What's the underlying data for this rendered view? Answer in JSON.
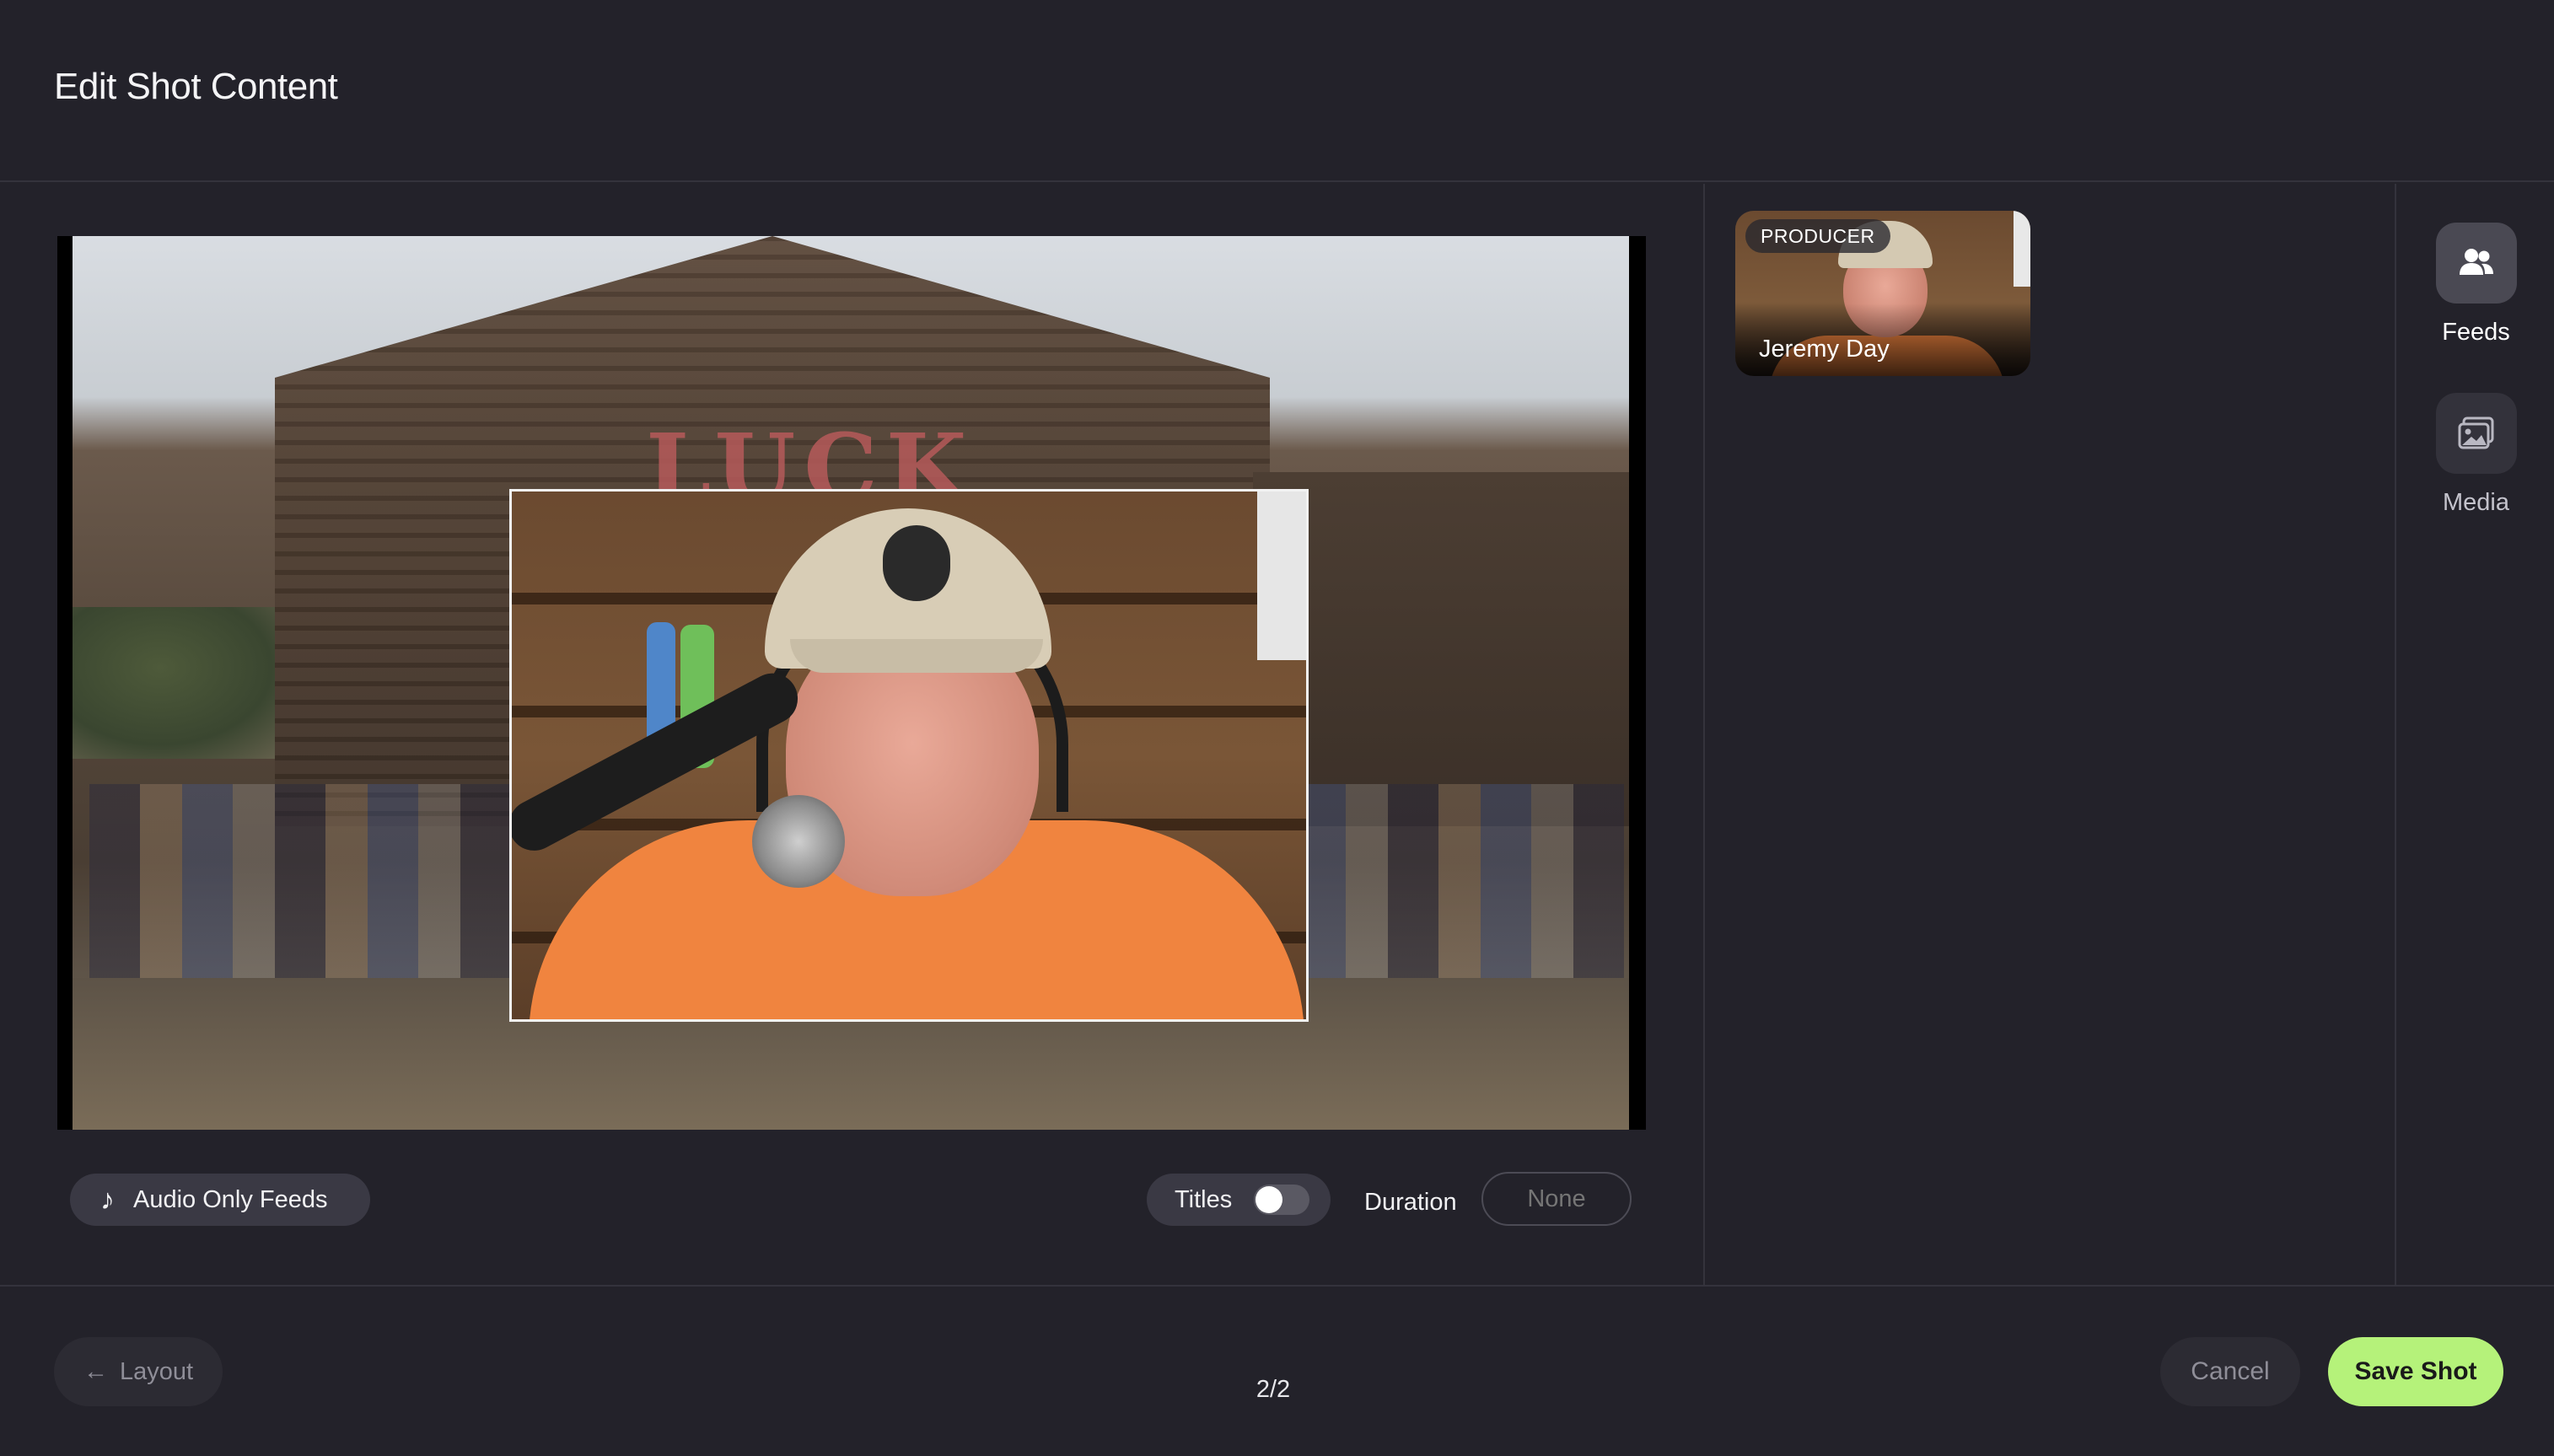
{
  "header": {
    "title": "Edit Shot Content"
  },
  "stage": {
    "background_sign_text": "LUCK"
  },
  "controls": {
    "audio_only_label": "Audio Only Feeds",
    "titles_label": "Titles",
    "titles_enabled": false,
    "duration_label": "Duration",
    "duration_placeholder": "None"
  },
  "feeds": [
    {
      "role": "PRODUCER",
      "name": "Jeremy Day"
    }
  ],
  "side_nav": {
    "items": [
      {
        "label": "Feeds",
        "icon": "people-icon",
        "active": true
      },
      {
        "label": "Media",
        "icon": "images-icon",
        "active": false
      }
    ]
  },
  "footer": {
    "layout_label": "Layout",
    "page_indicator": "2/2",
    "cancel_label": "Cancel",
    "save_label": "Save Shot"
  },
  "colors": {
    "background": "#23222a",
    "accent": "#b5f27a",
    "pill": "#3a3944"
  }
}
